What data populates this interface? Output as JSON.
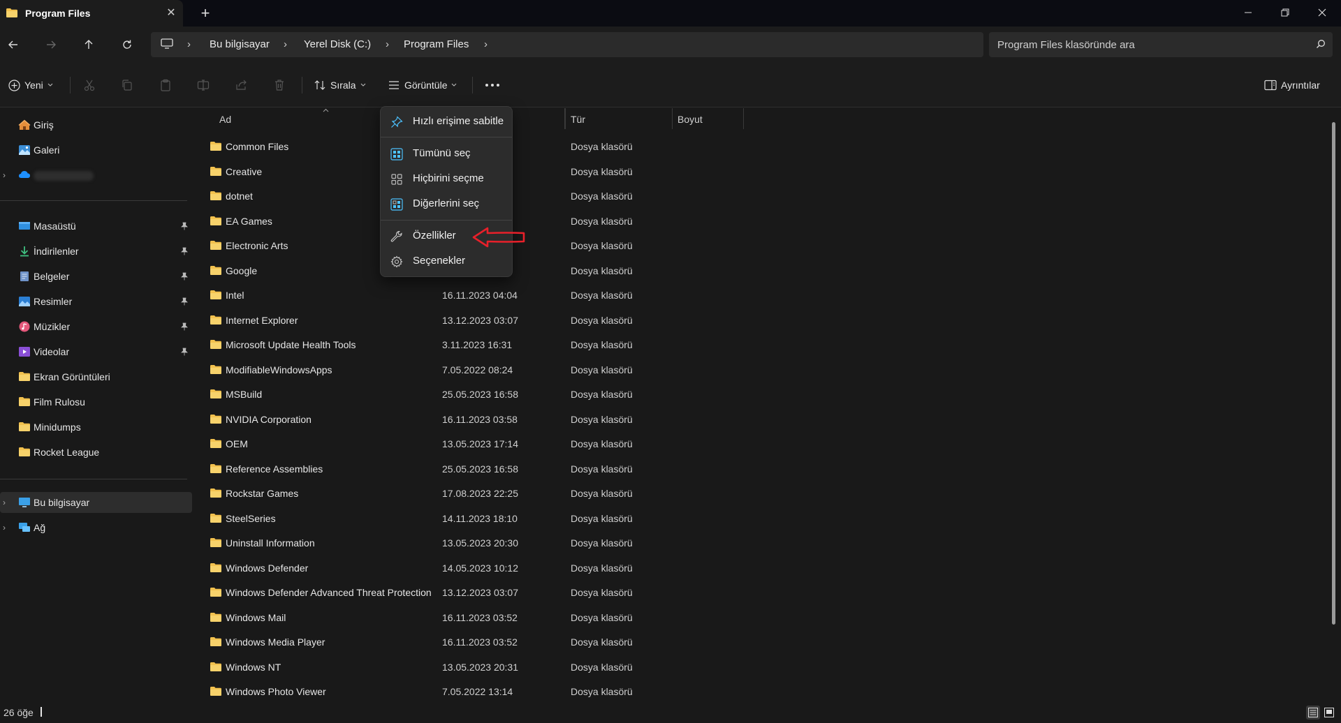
{
  "window": {
    "tab_title": "Program Files",
    "new_tab_symbol": "+",
    "close_tab_symbol": "✕"
  },
  "address": {
    "crumbs": [
      "Bu bilgisayar",
      "Yerel Disk (C:)",
      "Program Files"
    ],
    "search_placeholder": "Program Files klasöründe ara"
  },
  "toolbar": {
    "new_label": "Yeni",
    "sort_label": "Sırala",
    "view_label": "Görüntüle",
    "details_label": "Ayrıntılar"
  },
  "sidebar": {
    "top_items": [
      {
        "label": "Giriş",
        "icon": "home-icon"
      },
      {
        "label": "Galeri",
        "icon": "gallery-icon"
      }
    ],
    "pinned_items": [
      {
        "label": "Masaüstü",
        "icon": "desktop-icon"
      },
      {
        "label": "İndirilenler",
        "icon": "downloads-icon"
      },
      {
        "label": "Belgeler",
        "icon": "documents-icon"
      },
      {
        "label": "Resimler",
        "icon": "pictures-icon"
      },
      {
        "label": "Müzikler",
        "icon": "music-icon"
      },
      {
        "label": "Videolar",
        "icon": "videos-icon"
      }
    ],
    "folder_items": [
      "Ekran Görüntüleri",
      "Film Rulosu",
      "Minidumps",
      "Rocket League"
    ],
    "bottom_items": [
      {
        "label": "Bu bilgisayar",
        "icon": "this-pc-icon",
        "selected": true
      },
      {
        "label": "Ağ",
        "icon": "network-icon",
        "selected": false
      }
    ]
  },
  "columns": {
    "name": "Ad",
    "type": "Tür",
    "size": "Boyut"
  },
  "files": [
    {
      "name": "Common Files",
      "date": "",
      "type": "Dosya klasörü"
    },
    {
      "name": "Creative",
      "date": "",
      "type": "Dosya klasörü"
    },
    {
      "name": "dotnet",
      "date": "",
      "type": "Dosya klasörü"
    },
    {
      "name": "EA Games",
      "date": "",
      "type": "Dosya klasörü"
    },
    {
      "name": "Electronic Arts",
      "date": "",
      "type": "Dosya klasörü"
    },
    {
      "name": "Google",
      "date": "",
      "type": "Dosya klasörü"
    },
    {
      "name": "Intel",
      "date": "16.11.2023 04:04",
      "type": "Dosya klasörü"
    },
    {
      "name": "Internet Explorer",
      "date": "13.12.2023 03:07",
      "type": "Dosya klasörü"
    },
    {
      "name": "Microsoft Update Health Tools",
      "date": "3.11.2023 16:31",
      "type": "Dosya klasörü"
    },
    {
      "name": "ModifiableWindowsApps",
      "date": "7.05.2022 08:24",
      "type": "Dosya klasörü"
    },
    {
      "name": "MSBuild",
      "date": "25.05.2023 16:58",
      "type": "Dosya klasörü"
    },
    {
      "name": "NVIDIA Corporation",
      "date": "16.11.2023 03:58",
      "type": "Dosya klasörü"
    },
    {
      "name": "OEM",
      "date": "13.05.2023 17:14",
      "type": "Dosya klasörü"
    },
    {
      "name": "Reference Assemblies",
      "date": "25.05.2023 16:58",
      "type": "Dosya klasörü"
    },
    {
      "name": "Rockstar Games",
      "date": "17.08.2023 22:25",
      "type": "Dosya klasörü"
    },
    {
      "name": "SteelSeries",
      "date": "14.11.2023 18:10",
      "type": "Dosya klasörü"
    },
    {
      "name": "Uninstall Information",
      "date": "13.05.2023 20:30",
      "type": "Dosya klasörü"
    },
    {
      "name": "Windows Defender",
      "date": "14.05.2023 10:12",
      "type": "Dosya klasörü"
    },
    {
      "name": "Windows Defender Advanced Threat Protection",
      "date": "13.12.2023 03:07",
      "type": "Dosya klasörü"
    },
    {
      "name": "Windows Mail",
      "date": "16.11.2023 03:52",
      "type": "Dosya klasörü"
    },
    {
      "name": "Windows Media Player",
      "date": "16.11.2023 03:52",
      "type": "Dosya klasörü"
    },
    {
      "name": "Windows NT",
      "date": "13.05.2023 20:31",
      "type": "Dosya klasörü"
    },
    {
      "name": "Windows Photo Viewer",
      "date": "7.05.2022 13:14",
      "type": "Dosya klasörü"
    }
  ],
  "context_menu": {
    "items": [
      {
        "label": "Hızlı erişime sabitle",
        "icon": "pin-icon"
      },
      {
        "label": "Tümünü seç",
        "icon": "select-all-icon"
      },
      {
        "label": "Hiçbirini seçme",
        "icon": "select-none-icon"
      },
      {
        "label": "Diğerlerini seç",
        "icon": "invert-selection-icon"
      },
      {
        "label": "Özellikler",
        "icon": "properties-icon"
      },
      {
        "label": "Seçenekler",
        "icon": "options-icon"
      }
    ]
  },
  "status": {
    "item_count": "26 öğe"
  },
  "colors": {
    "folder": "#f2c14e",
    "annotation_arrow": "#e8202a",
    "accent": "#4cc2ff"
  }
}
